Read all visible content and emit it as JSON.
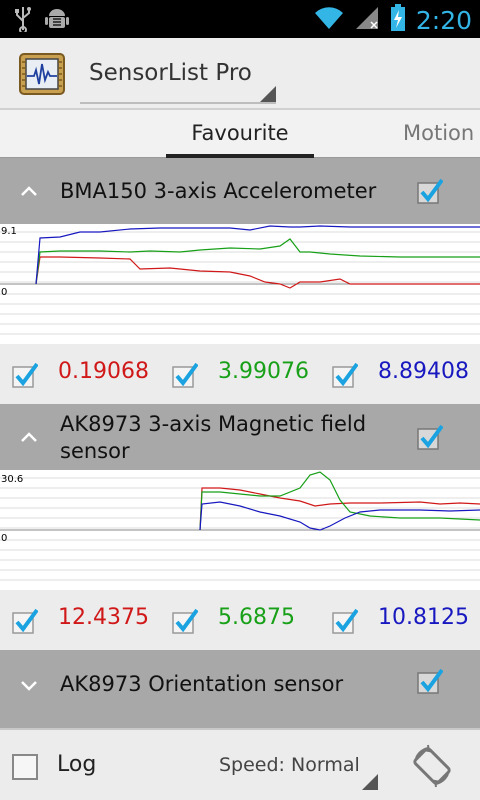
{
  "status_bar": {
    "time": "2:20",
    "icons": [
      "usb-icon",
      "android-debug-icon",
      "wifi-icon",
      "signal-icon",
      "battery-charging-icon"
    ]
  },
  "app": {
    "title": "SensorList Pro",
    "icon": "sensor-waveform-icon"
  },
  "tabs": [
    {
      "label": "Favourite",
      "selected": true
    },
    {
      "label": "Motion",
      "selected": false
    }
  ],
  "sensors": [
    {
      "name": "BMA150 3-axis Accelerometer",
      "expanded": true,
      "checked": true,
      "graph": {
        "max_label": "9.1",
        "zero_label": "0"
      },
      "values": [
        {
          "text": "0.19068",
          "color": "#d01818",
          "checked": true
        },
        {
          "text": "3.99076",
          "color": "#18a018",
          "checked": true
        },
        {
          "text": "8.89408",
          "color": "#1818c0",
          "checked": true
        }
      ]
    },
    {
      "name": "AK8973 3-axis Magnetic field sensor",
      "expanded": true,
      "checked": true,
      "graph": {
        "max_label": "30.6",
        "zero_label": "0"
      },
      "values": [
        {
          "text": "12.4375",
          "color": "#d01818",
          "checked": true
        },
        {
          "text": "5.6875",
          "color": "#18a018",
          "checked": true
        },
        {
          "text": "10.8125",
          "color": "#1818c0",
          "checked": true
        }
      ]
    },
    {
      "name": "AK8973 Orientation sensor",
      "expanded": false,
      "checked": true
    }
  ],
  "bottom_bar": {
    "log_label": "Log",
    "log_checked": false,
    "speed_label": "Speed: Normal",
    "rotate_icon": "screen-rotation-icon"
  },
  "colors": {
    "accent": "#33b5e5",
    "x_axis": "#d01818",
    "y_axis": "#18a018",
    "z_axis": "#1818c0",
    "header_bg": "#a8a8a8"
  }
}
